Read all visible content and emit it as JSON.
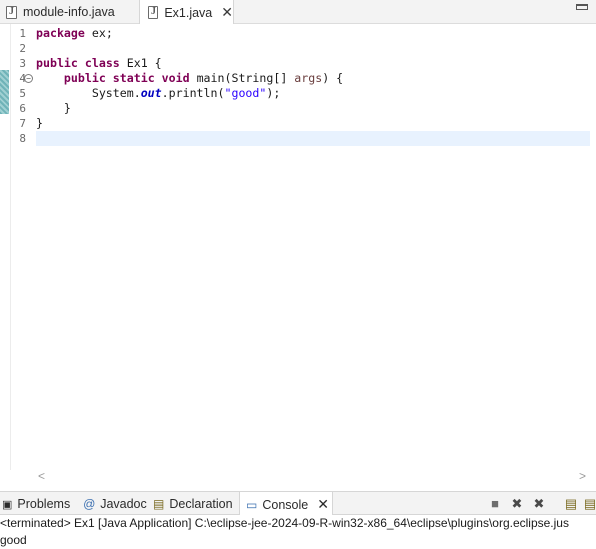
{
  "editor_tabs": [
    {
      "label": "module-info.java"
    },
    {
      "label": "Ex1.java"
    }
  ],
  "code_lines": [
    {
      "num": "1",
      "parts": [
        {
          "t": "package",
          "c": "kw"
        },
        {
          "t": " ex;",
          "c": ""
        }
      ]
    },
    {
      "num": "2",
      "parts": []
    },
    {
      "num": "3",
      "parts": [
        {
          "t": "public",
          "c": "kw"
        },
        {
          "t": " ",
          "c": ""
        },
        {
          "t": "class",
          "c": "kw"
        },
        {
          "t": " Ex1 {",
          "c": ""
        }
      ]
    },
    {
      "num": "4",
      "fold": "⊖",
      "parts": [
        {
          "t": "    ",
          "c": ""
        },
        {
          "t": "public",
          "c": "kw"
        },
        {
          "t": " ",
          "c": ""
        },
        {
          "t": "static",
          "c": "kw"
        },
        {
          "t": " ",
          "c": ""
        },
        {
          "t": "void",
          "c": "kw"
        },
        {
          "t": " main(String[] ",
          "c": ""
        },
        {
          "t": "args",
          "c": "param"
        },
        {
          "t": ") {",
          "c": ""
        }
      ]
    },
    {
      "num": "5",
      "parts": [
        {
          "t": "        System.",
          "c": ""
        },
        {
          "t": "out",
          "c": "field"
        },
        {
          "t": ".println(",
          "c": ""
        },
        {
          "t": "\"good\"",
          "c": "str"
        },
        {
          "t": ");",
          "c": ""
        }
      ]
    },
    {
      "num": "6",
      "parts": [
        {
          "t": "    }",
          "c": ""
        }
      ]
    },
    {
      "num": "7",
      "parts": [
        {
          "t": "}",
          "c": ""
        }
      ]
    },
    {
      "num": "8",
      "parts": []
    }
  ],
  "bottom_tabs": {
    "problems": "Problems",
    "javadoc": "Javadoc",
    "declaration": "Declaration",
    "console": "Console"
  },
  "console": {
    "terminated_line": "<terminated> Ex1 [Java Application] C:\\eclipse-jee-2024-09-R-win32-x86_64\\eclipse\\plugins\\org.eclipse.jus",
    "output": "good"
  },
  "icons": {
    "close": "close-icon",
    "minimize": "minimize-icon",
    "terminate": "terminate-icon",
    "remove_launch": "remove-launch-icon",
    "remove_all": "remove-all-launches-icon",
    "scroll_lock": "scroll-lock-icon"
  }
}
